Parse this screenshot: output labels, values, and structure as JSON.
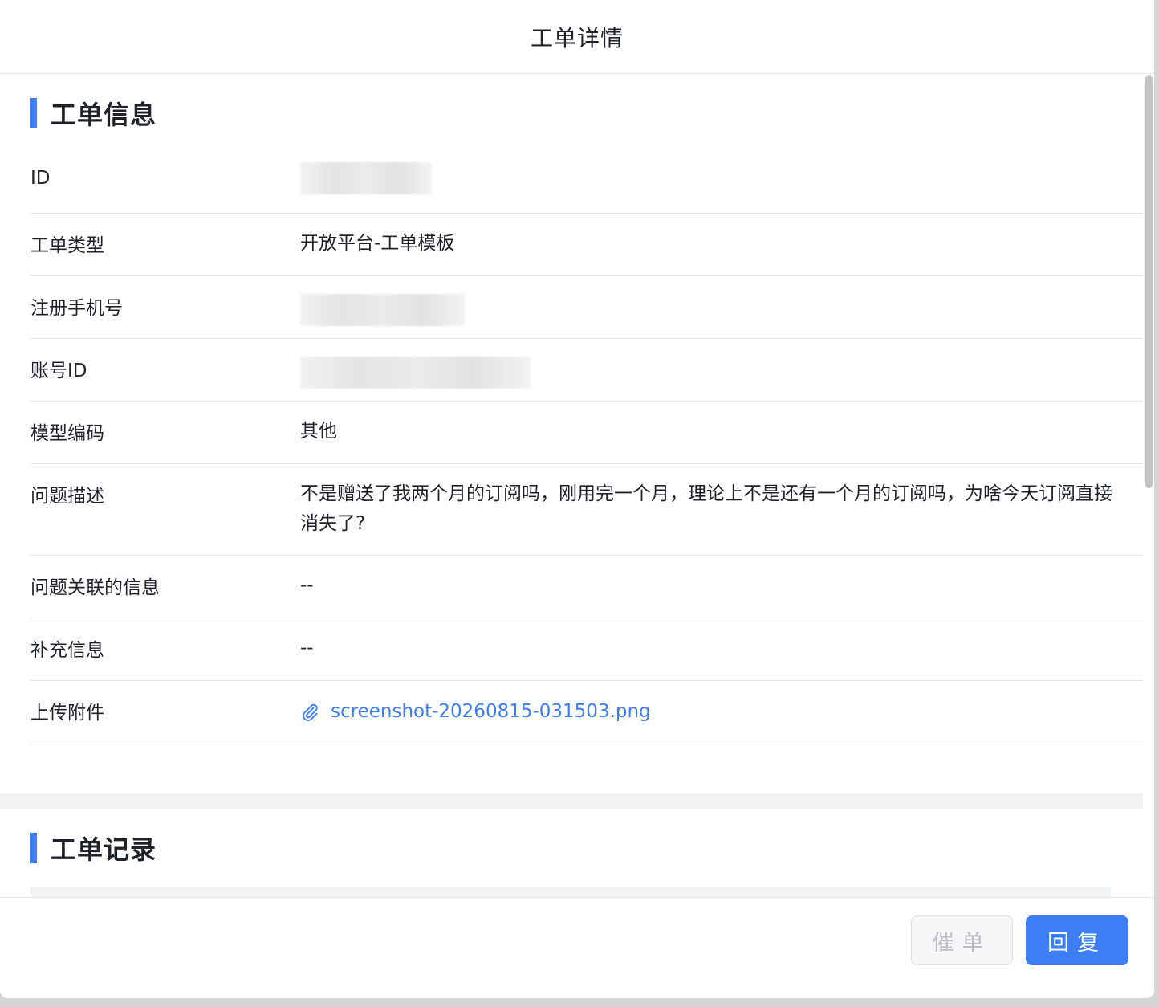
{
  "modal": {
    "title": "工单详情"
  },
  "info_section": {
    "title": "工单信息",
    "rows": [
      {
        "label": "ID",
        "value": ""
      },
      {
        "label": "工单类型",
        "value": "开放平台-工单模板"
      },
      {
        "label": "注册手机号",
        "value": ""
      },
      {
        "label": "账号ID",
        "value": ""
      },
      {
        "label": "模型编码",
        "value": "其他"
      },
      {
        "label": "问题描述",
        "value": "不是赠送了我两个月的订阅吗，刚用完一个月，理论上不是还有一个月的订阅吗，为啥今天订阅直接消失了?"
      },
      {
        "label": "问题关联的信息",
        "value": "--"
      },
      {
        "label": "补充信息",
        "value": "--"
      },
      {
        "label": "上传附件",
        "value": "screenshot-20260815-031503.png"
      }
    ],
    "attachment_icon": "paperclip-icon"
  },
  "record_section": {
    "title": "工单记录"
  },
  "footer": {
    "urge_label": "催单",
    "reply_label": "回复"
  },
  "colors": {
    "accent": "#3d7ef5",
    "border": "#e5e6eb",
    "disabled_text": "#b8bcc3"
  }
}
